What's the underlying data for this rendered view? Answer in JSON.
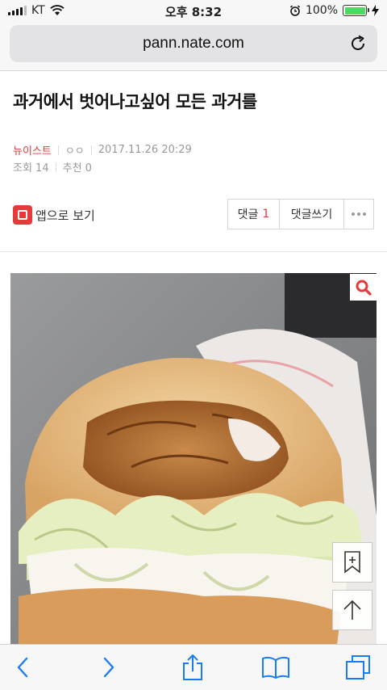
{
  "status_bar": {
    "carrier": "KT",
    "time": "오후 8:32",
    "battery_percent": "100%",
    "battery_level": 1.0
  },
  "browser": {
    "url": "pann.nate.com"
  },
  "article": {
    "title": "과거에서 벗어나고싶어 모든 과거를",
    "category": "뉴이스트",
    "author": "ㅇㅇ",
    "date": "2017.11.26 20:29",
    "views": "조회 14",
    "likes": "추천 0"
  },
  "actions": {
    "app_view_label": "앱으로 보기",
    "comments_label": "댓글",
    "comments_count": "1",
    "write_comment_label": "댓글쓰기"
  },
  "icons": {
    "zoom": "search-icon",
    "bookmark": "bookmark-add-icon",
    "top": "arrow-up-icon",
    "toolbar": [
      "back-icon",
      "forward-icon",
      "share-icon",
      "bookmarks-icon",
      "tabs-icon"
    ]
  },
  "colors": {
    "accent": "#e53a3a",
    "ios_blue": "#1a7cf5",
    "battery": "#4cd964"
  }
}
